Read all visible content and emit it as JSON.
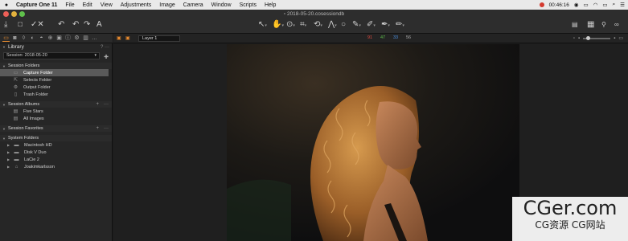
{
  "menubar": {
    "app_name": "Capture One 11",
    "items": [
      "File",
      "Edit",
      "View",
      "Adjustments",
      "Image",
      "Camera",
      "Window",
      "Scripts",
      "Help"
    ],
    "clock": "00:46:16"
  },
  "window": {
    "title": "2018-05-20.cosessiondb"
  },
  "viewer": {
    "layer": "Layer 1",
    "rgb": {
      "r": "91",
      "g": "47",
      "b": "33",
      "l": "56"
    }
  },
  "library": {
    "title": "Library",
    "session_select": "Session: 2018-05-20",
    "sections": {
      "session_folders": {
        "label": "Session Folders",
        "items": [
          "Capture Folder",
          "Selects Folder",
          "Output Folder",
          "Trash Folder"
        ]
      },
      "session_albums": {
        "label": "Session Albums",
        "items": [
          "Five Stars",
          "All Images"
        ]
      },
      "session_favorites": {
        "label": "Session Favorites"
      },
      "system_folders": {
        "label": "System Folders",
        "items": [
          "Macintosh HD",
          "Disk V Duo",
          "LaCie 2",
          "Joakimkarlsson"
        ]
      }
    }
  },
  "watermark": {
    "main": "CGer.com",
    "sub": "CG资源 CG网站"
  },
  "colors": {
    "accent": "#e98b2f",
    "panel_bg": "#262626",
    "selected_row": "#5a5a5a"
  }
}
